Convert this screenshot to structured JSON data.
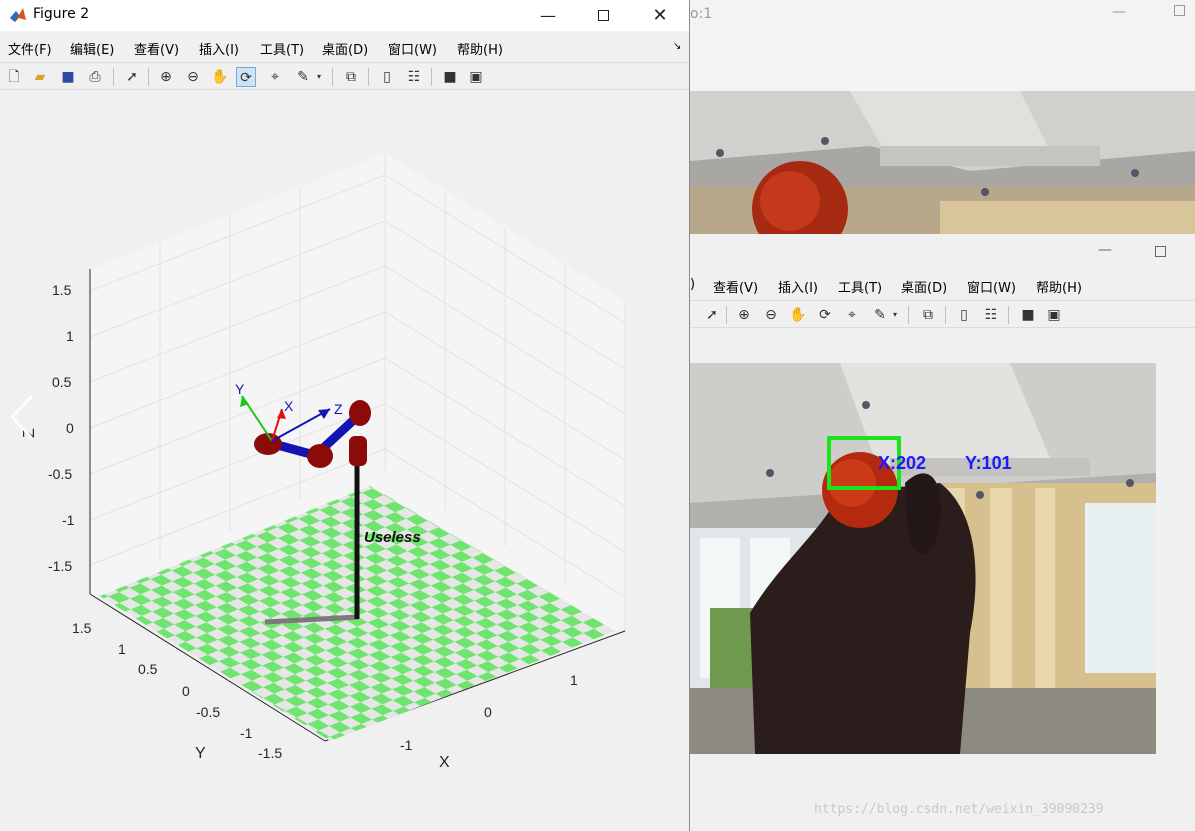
{
  "figure2": {
    "title": "Figure 2",
    "menu": [
      "文件(F)",
      "编辑(E)",
      "查看(V)",
      "插入(I)",
      "工具(T)",
      "桌面(D)",
      "窗口(W)",
      "帮助(H)"
    ],
    "toolbar_icons": [
      "new-file-icon",
      "open-folder-icon",
      "save-icon",
      "print-icon",
      "pointer-icon",
      "zoom-in-icon",
      "zoom-out-icon",
      "pan-hand-icon",
      "rotate-3d-icon",
      "data-cursor-icon",
      "brush-icon",
      "link-plot-icon",
      "colorbar-icon",
      "legend-icon",
      "hide-plot-tools-icon",
      "show-plot-tools-icon"
    ],
    "plot": {
      "z_ticks": [
        "1.5",
        "1",
        "0.5",
        "0",
        "-0.5",
        "-1",
        "-1.5"
      ],
      "y_ticks": [
        "1.5",
        "1",
        "0.5",
        "0",
        "-0.5",
        "-1",
        "-1.5"
      ],
      "x_ticks": [
        "1",
        "0",
        "-1"
      ],
      "xlabel": "X",
      "ylabel": "Y",
      "zlabel": "Z",
      "robot_label": "Useless",
      "frame_labels": {
        "x": "X",
        "y": "Y",
        "z": "Z"
      }
    }
  },
  "back_window": {
    "title": "o:1"
  },
  "camera_window": {
    "menu": [
      ")",
      "查看(V)",
      "插入(I)",
      "工具(T)",
      "桌面(D)",
      "窗口(W)",
      "帮助(H)"
    ],
    "tracking_x": "X:202",
    "tracking_y": "Y:101",
    "watermark": "https://blog.csdn.net/weixin_39090239"
  },
  "colors": {
    "checker_green": "#6fe46f",
    "checker_light": "#e6e6e6",
    "link_blue": "#1414b4",
    "joint_red": "#8b0a0a",
    "tracker_green": "#19e619",
    "tracker_text": "#1a1aff"
  }
}
